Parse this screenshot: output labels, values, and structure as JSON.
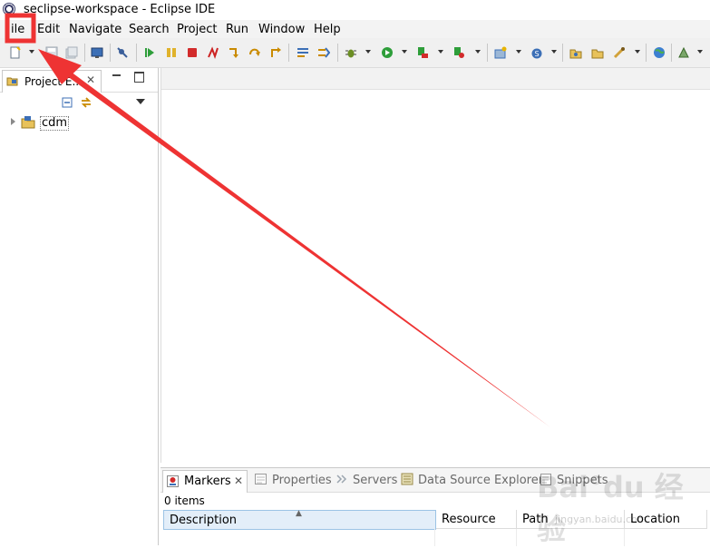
{
  "window": {
    "title": "seclipse-workspace - Eclipse IDE"
  },
  "menubar": {
    "items": [
      "ile",
      "Edit",
      "Navigate",
      "Search",
      "Project",
      "Run",
      "Window",
      "Help"
    ]
  },
  "toolbar": {
    "icons": [
      "new-file-icon",
      "save-icon",
      "save-all-icon",
      "terminal-icon",
      "skip-breakpoints-icon",
      "resume-icon",
      "suspend-icon",
      "terminate-icon",
      "disconnect-icon",
      "step-into-icon",
      "step-over-icon",
      "step-return-icon",
      "drop-to-frame-icon",
      "use-step-filters-icon",
      "debug-icon",
      "run-icon",
      "coverage-icon",
      "external-tools-icon",
      "new-server-icon",
      "new-java-class-icon",
      "open-type-icon",
      "open-folder-icon",
      "search-icon",
      "globe-icon",
      "perspective-icon"
    ]
  },
  "project_explorer": {
    "tab_label": "Project E...",
    "tree": [
      {
        "label": "cdm"
      }
    ]
  },
  "bottom_panel": {
    "tabs": [
      "Markers",
      "Properties",
      "Servers",
      "Data Source Explorer",
      "Snippets"
    ],
    "items_count": "0 items",
    "columns": [
      "Description",
      "Resource",
      "Path",
      "Location"
    ]
  },
  "annotation": {
    "color": "#ee3333"
  },
  "watermark": {
    "text": "Bai°du 经验",
    "url": "jingyan.baidu.com"
  }
}
